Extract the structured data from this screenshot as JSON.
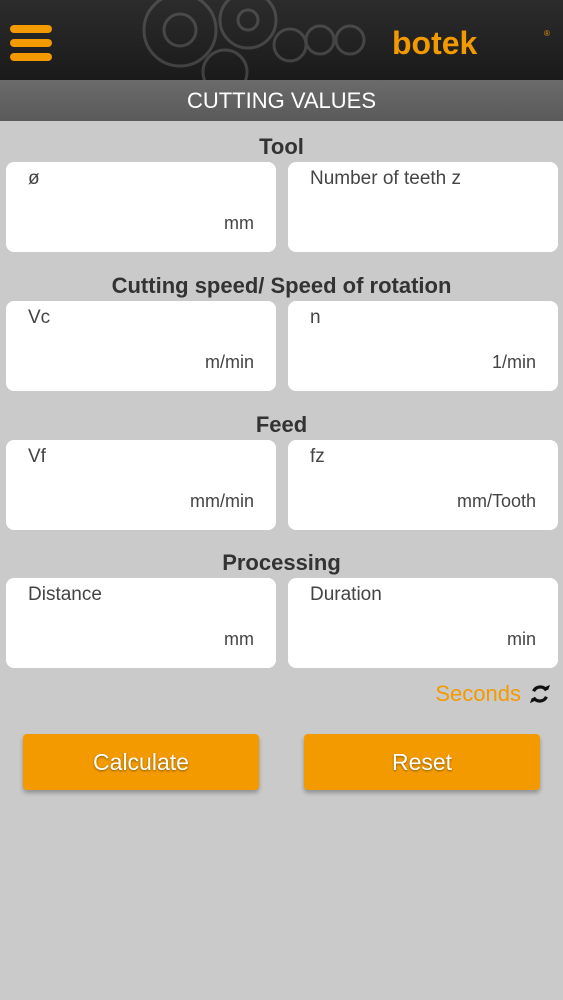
{
  "header": {
    "brand": "botek",
    "menu_icon": "hamburger-menu-icon",
    "brand_color": "#f39a00"
  },
  "title": "CUTTING VALUES",
  "sections": [
    {
      "title": "Tool",
      "fields": [
        {
          "label": "ø",
          "unit": "mm",
          "value": ""
        },
        {
          "label": "Number of teeth z",
          "unit": "",
          "value": ""
        }
      ]
    },
    {
      "title": "Cutting speed/ Speed of rotation",
      "fields": [
        {
          "label": "Vc",
          "unit": "m/min",
          "value": ""
        },
        {
          "label": "n",
          "unit": "1/min",
          "value": ""
        }
      ]
    },
    {
      "title": "Feed",
      "fields": [
        {
          "label": "Vf",
          "unit": "mm/min",
          "value": ""
        },
        {
          "label": "fz",
          "unit": "mm/Tooth",
          "value": ""
        }
      ]
    },
    {
      "title": "Processing",
      "fields": [
        {
          "label": "Distance",
          "unit": "mm",
          "value": ""
        },
        {
          "label": "Duration",
          "unit": "min",
          "value": ""
        }
      ]
    }
  ],
  "time_toggle": {
    "label": "Seconds",
    "icon": "refresh-icon"
  },
  "buttons": {
    "calculate": "Calculate",
    "reset": "Reset"
  }
}
